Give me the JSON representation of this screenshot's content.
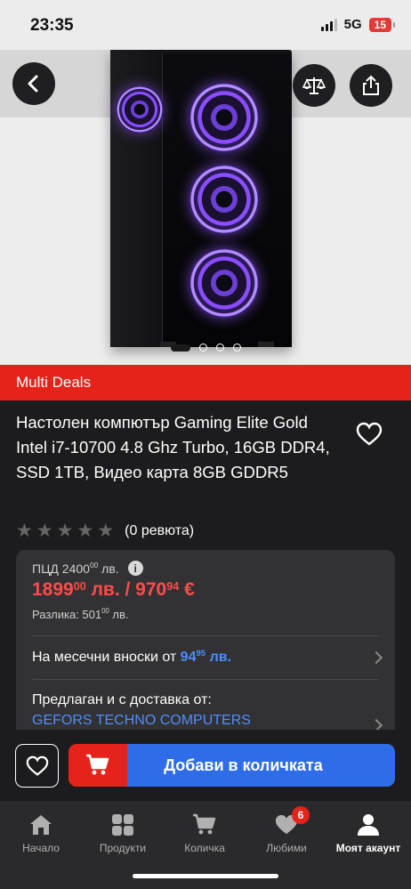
{
  "status_bar": {
    "time": "23:35",
    "network": "5G",
    "battery": "15"
  },
  "hero": {
    "image_index": 1,
    "image_count": 4
  },
  "deal_banner": "Multi Deals",
  "product": {
    "title": "Настолен компютър Gaming Elite Gold Intel i7-10700 4.8 Ghz Turbo, 16GB DDR4, SSD 1TB, Видео карта 8GB GDDR5",
    "rating": 0,
    "reviews_text": "(0 ревюта)"
  },
  "price": {
    "rrp_label": "ПЦД 2400",
    "rrp_cents": "00",
    "rrp_currency": "лв.",
    "main_lev": "1899",
    "main_lev_cents": "00",
    "main_sep": "лв. / 970",
    "main_eur_cents": "94",
    "main_eur": "€",
    "diff_label": "Разлика: 501",
    "diff_cents": "00",
    "diff_currency": "лв."
  },
  "installments": {
    "label": "На месечни вноски от",
    "amount": "94",
    "amount_cents": "95",
    "currency": "лв."
  },
  "seller": {
    "label": "Предлаган и с доставка от:",
    "name": "GEFORS TECHNO COMPUTERS"
  },
  "add_to_cart": "Добави в количката",
  "nav": [
    {
      "label": "Начало",
      "icon": "home-icon"
    },
    {
      "label": "Продукти",
      "icon": "grid-icon"
    },
    {
      "label": "Количка",
      "icon": "cart-icon"
    },
    {
      "label": "Любими",
      "icon": "heart-icon",
      "badge": "6"
    },
    {
      "label": "Моят акаунт",
      "icon": "user-icon",
      "active": true
    }
  ],
  "colors": {
    "accent_red": "#e5231b",
    "accent_blue": "#2f6de8",
    "price_red": "#ff4b4b",
    "link_blue": "#4f8dff"
  }
}
